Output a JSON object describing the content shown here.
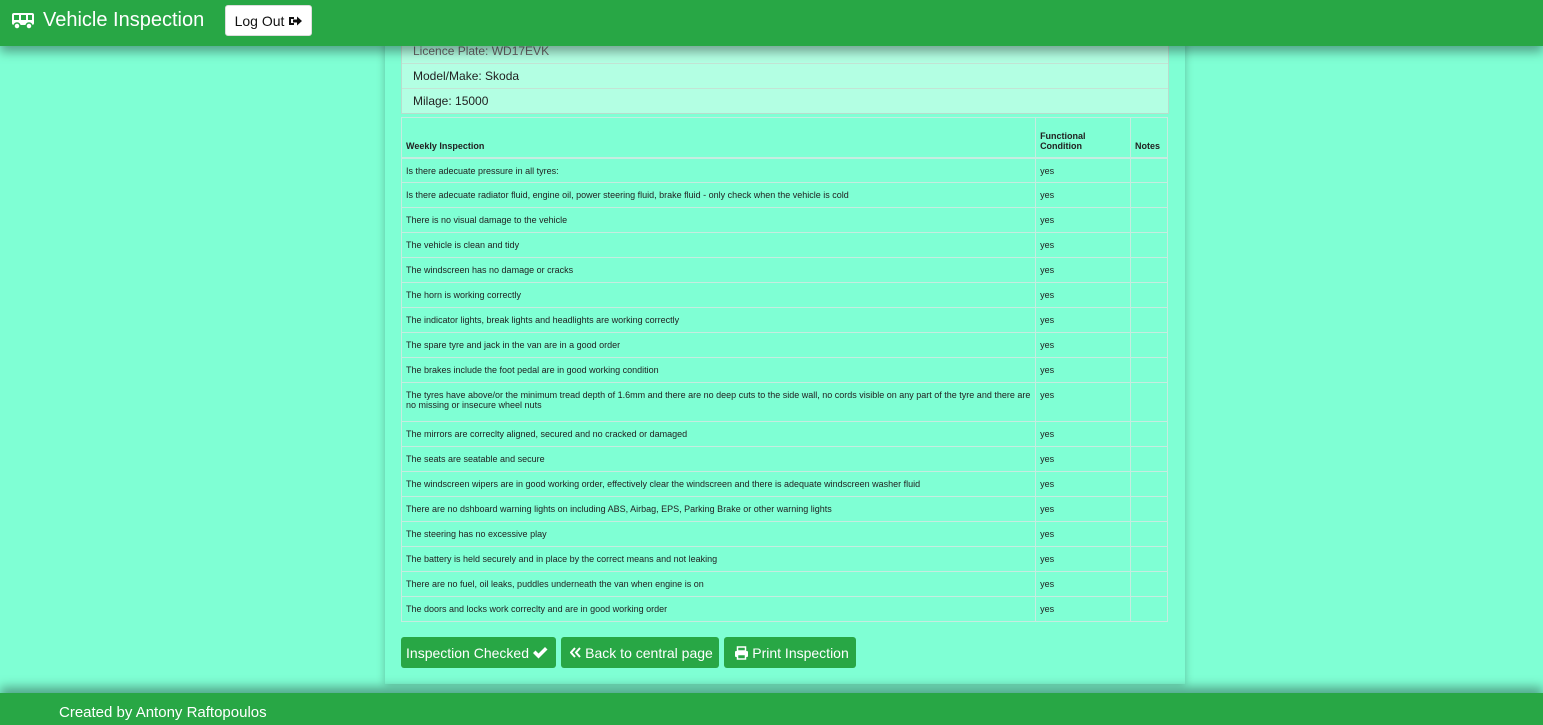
{
  "navbar": {
    "brand_icon": "bus-icon",
    "title": "Vehicle Inspection",
    "logout_label": "Log Out",
    "logout_icon": "sign-out-icon"
  },
  "vehicle": {
    "licence_plate": "Licence Plate: WD17EVK",
    "model_make": "Model/Make: Skoda",
    "milage": "Milage: 15000"
  },
  "table": {
    "headers": {
      "question": "Weekly Inspection",
      "functional": "Functional Condition",
      "notes": "Notes"
    },
    "rows": [
      {
        "question": "Is there adecuate pressure in all tyres:",
        "functional": "yes",
        "notes": ""
      },
      {
        "question": "Is there adecuate radiator fluid, engine oil, power steering fluid, brake fluid - only check when the vehicle is cold",
        "functional": "yes",
        "notes": ""
      },
      {
        "question": "There is no visual damage to the vehicle",
        "functional": "yes",
        "notes": ""
      },
      {
        "question": "The vehicle is clean and tidy",
        "functional": "yes",
        "notes": ""
      },
      {
        "question": "The windscreen has no damage or cracks",
        "functional": "yes",
        "notes": ""
      },
      {
        "question": "The horn is working correctly",
        "functional": "yes",
        "notes": ""
      },
      {
        "question": "The indicator lights, break lights and headlights are working correctly",
        "functional": "yes",
        "notes": ""
      },
      {
        "question": "The spare tyre and jack in the van are in a good order",
        "functional": "yes",
        "notes": ""
      },
      {
        "question": "The brakes include the foot pedal are in good working condition",
        "functional": "yes",
        "notes": ""
      },
      {
        "question": "The tyres have above/or the minimum tread depth of 1.6mm and there are no deep cuts to the side wall, no cords visible on any part of the tyre and there are no missing or insecure wheel nuts",
        "functional": "yes",
        "notes": ""
      },
      {
        "question": "The mirrors are correclty aligned, secured and no cracked or damaged",
        "functional": "yes",
        "notes": ""
      },
      {
        "question": "The seats are seatable and secure",
        "functional": "yes",
        "notes": ""
      },
      {
        "question": "The windscreen wipers are in good working order, effectively clear the windscreen and there is adequate windscreen washer fluid",
        "functional": "yes",
        "notes": ""
      },
      {
        "question": "There are no dshboard warning lights on including ABS, Airbag, EPS, Parking Brake or other warning lights",
        "functional": "yes",
        "notes": ""
      },
      {
        "question": "The steering has no excessive play",
        "functional": "yes",
        "notes": ""
      },
      {
        "question": "The battery is held securely and in place by the correct means and not leaking",
        "functional": "yes",
        "notes": ""
      },
      {
        "question": "There are no fuel, oil leaks, puddles underneath the van when engine is on",
        "functional": "yes",
        "notes": ""
      },
      {
        "question": "The doors and locks work correclty and are in good working order",
        "functional": "yes",
        "notes": ""
      }
    ]
  },
  "actions": {
    "checked_label": "Inspection Checked",
    "checked_icon": "check-icon",
    "back_label": "Back to central page",
    "back_icon": "angle-double-left-icon",
    "print_label": "Print Inspection",
    "print_icon": "print-icon"
  },
  "footer": {
    "credit": "Created by Antony Raftopoulos"
  },
  "colors": {
    "primary_green": "#28a745",
    "page_background": "#7fffd4",
    "info_item_background": "#b3ffe3"
  }
}
